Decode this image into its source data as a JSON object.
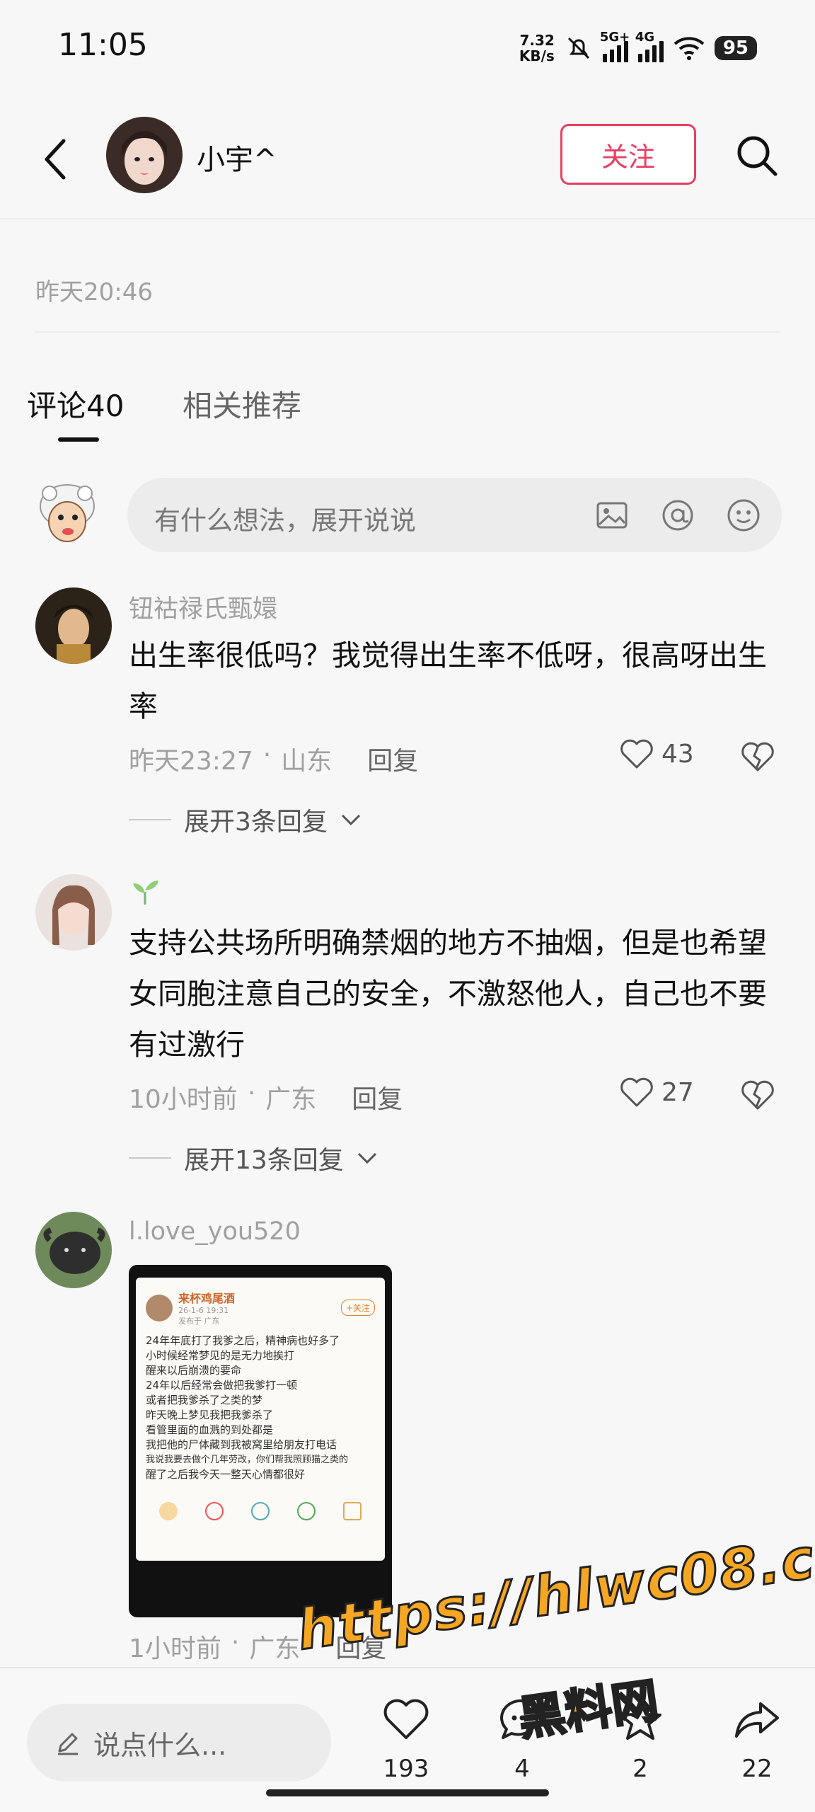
{
  "status_bar": {
    "time": "11:05",
    "net_speed_value": "7.32",
    "net_speed_unit": "KB/s",
    "signal1_label": "5G+",
    "signal2_label": "4G",
    "battery": "95"
  },
  "header": {
    "back_icon": "back-arrow-icon",
    "author_name": "小宇^",
    "follow_label": "关注",
    "search_icon": "search-icon"
  },
  "post": {
    "time": "昨天20:46"
  },
  "tabs": [
    {
      "label": "评论40",
      "active": true
    },
    {
      "label": "相关推荐",
      "active": false
    }
  ],
  "comment_input": {
    "placeholder": "有什么想法，展开说说"
  },
  "comments": [
    {
      "user": "钮祜禄氏甄嬛",
      "text": "出生率很低吗？我觉得出生率不低呀，很高呀出生率",
      "time": "昨天23:27",
      "location": "山东",
      "reply_label": "回复",
      "likes": "43",
      "expand_label": "展开3条回复"
    },
    {
      "user": "",
      "text": "支持公共场所明确禁烟的地方不抽烟，但是也希望女同胞注意自己的安全，不激怒他人，自己也不要有过激行",
      "time": "10小时前",
      "location": "广东",
      "reply_label": "回复",
      "likes": "27",
      "expand_label": "展开13条回复"
    },
    {
      "user": "l.love_you520",
      "time": "1小时前",
      "location": "广东",
      "reply_label": "回复",
      "image": {
        "header_name": "来杯鸡尾酒",
        "header_time": "26-1-6 19:31",
        "header_loc": "发布于 广东",
        "follow": "+关注",
        "lines": [
          "24年年底打了我爹之后，精神病也好多了",
          "小时候经常梦见的是无力地挨打",
          "醒来以后崩溃的要命",
          "24年以后经常会做把我爹打一顿",
          "或者把我爹杀了之类的梦",
          "昨天晚上梦见我把我爹杀了",
          "看管里面的血溅的到处都是",
          "我把他的尸体藏到我被窝里给朋友打电话",
          "我说我要去做个几年劳改，你们帮我照顾猫之类的",
          "醒了之后我今天一整天心情都很好"
        ]
      }
    }
  ],
  "bottom_bar": {
    "input_placeholder": "说点什么...",
    "like_count": "193",
    "comment_count": "4",
    "collect_count": "2",
    "share_count": "22"
  },
  "watermark": {
    "url": "https://hlwc08.com",
    "name": "黑料网"
  },
  "colors": {
    "accent": "#e83f62",
    "background": "#f7f7f7",
    "muted_text": "#a0a0a0",
    "watermark": "#f5a623"
  }
}
